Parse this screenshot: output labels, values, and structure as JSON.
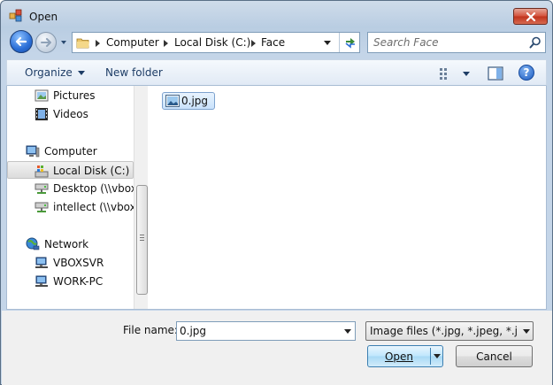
{
  "window": {
    "title": "Open"
  },
  "navigation": {
    "breadcrumbs": [
      "Computer",
      "Local Disk (C:)",
      "Face"
    ],
    "search_placeholder": "Search Face"
  },
  "toolbar": {
    "organize_label": "Organize",
    "new_folder_label": "New folder"
  },
  "sidebar": {
    "items": [
      {
        "label": "Pictures",
        "icon": "pictures-library-icon"
      },
      {
        "label": "Videos",
        "icon": "videos-library-icon"
      },
      {
        "label": "Computer",
        "icon": "computer-icon"
      },
      {
        "label": "Local Disk (C:)",
        "icon": "local-disk-icon",
        "selected": true
      },
      {
        "label": "Desktop (\\\\vboxs",
        "icon": "network-drive-icon"
      },
      {
        "label": "intellect (\\\\vbox",
        "icon": "network-drive-icon"
      },
      {
        "label": "Network",
        "icon": "network-icon"
      },
      {
        "label": "VBOXSVR",
        "icon": "network-computer-icon"
      },
      {
        "label": "WORK-PC",
        "icon": "network-computer-icon"
      }
    ]
  },
  "files": [
    {
      "name": "0.jpg",
      "icon": "image-file-icon",
      "selected": true
    }
  ],
  "footer": {
    "file_name_label": "File name:",
    "file_name_value": "0.jpg",
    "file_type_value": "Image files (*.jpg, *.jpeg, *.jpe, *",
    "open_label": "Open",
    "cancel_label": "Cancel"
  },
  "colors": {
    "frame": "#c4d5e8",
    "selection": "#cce4fb",
    "accent": "#3c7fb1"
  }
}
